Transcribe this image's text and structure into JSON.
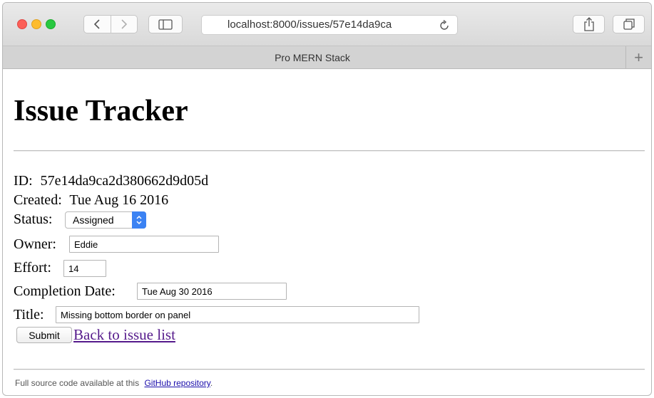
{
  "browser": {
    "url_text": "localhost:8000/issues/57e14da9ca",
    "tab_title": "Pro MERN Stack",
    "new_tab_symbol": "+"
  },
  "page": {
    "heading": "Issue Tracker",
    "id_label": "ID:",
    "id_value": "57e14da9ca2d380662d9d05d",
    "created_label": "Created:",
    "created_value": "Tue Aug 16 2016",
    "status_label": "Status:",
    "status_value": "Assigned",
    "owner_label": "Owner:",
    "owner_value": "Eddie",
    "effort_label": "Effort:",
    "effort_value": "14",
    "completion_label": "Completion Date:",
    "completion_value": "Tue Aug 30 2016",
    "title_label": "Title:",
    "title_value": "Missing bottom border on panel",
    "submit_label": "Submit",
    "back_link": "Back to issue list"
  },
  "footer": {
    "prefix": "Full source code available at this",
    "link": "GitHub repository",
    "suffix": "."
  },
  "icons": {
    "back": "chevron-left-icon",
    "forward": "chevron-right-icon",
    "sidebar": "sidebar-icon",
    "reload": "reload-icon",
    "share": "share-icon",
    "tabs": "tabs-overview-icon"
  },
  "colors": {
    "link_visited": "#551a8b",
    "select_accent": "#3b82f3",
    "close": "#fc5f57",
    "minimize": "#fdbc2e",
    "zoom": "#28c840"
  }
}
